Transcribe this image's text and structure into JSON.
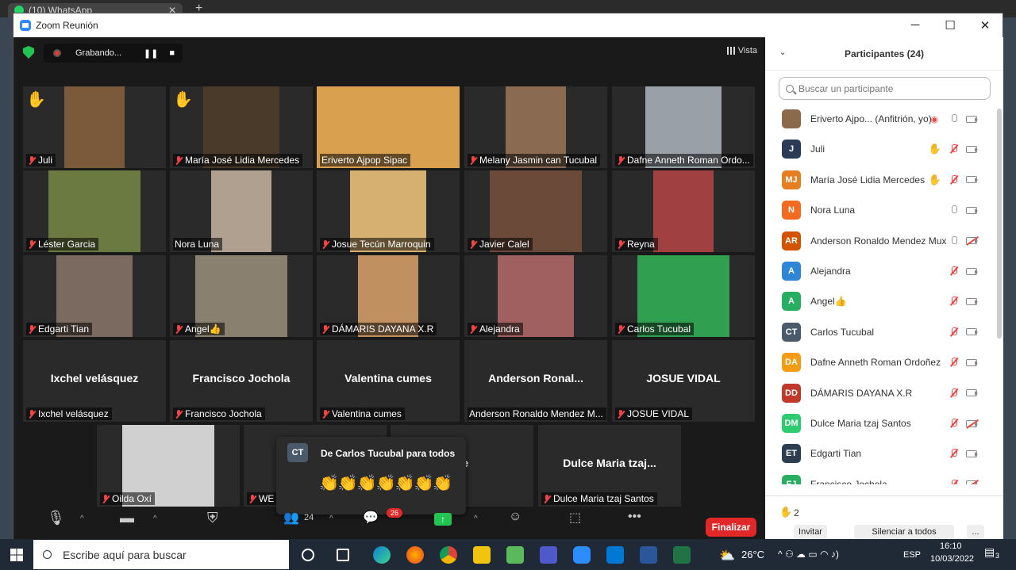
{
  "browser_tab": {
    "label": "(10) WhatsApp"
  },
  "window": {
    "title": "Zoom Reunión"
  },
  "recording": {
    "label": "Grabando..."
  },
  "view": {
    "label": "Vista"
  },
  "tiles": [
    {
      "name": "Juli",
      "hand": true,
      "video": true
    },
    {
      "name": "María José Lidia Mercedes",
      "hand": true,
      "video": true
    },
    {
      "name": "Eriverto Ajpop Sipac",
      "video": true,
      "speaking": true,
      "unmuted": true
    },
    {
      "name": "Melany Jasmin can Tucubal",
      "video": true
    },
    {
      "name": "Dafne Anneth Roman Ordo...",
      "video": true
    },
    {
      "name": "Léster Garcia",
      "video": true
    },
    {
      "name": "Nora Luna",
      "video": true,
      "unmuted": true
    },
    {
      "name": "Josue Tecún Marroquin",
      "video": true
    },
    {
      "name": "Javier Calel",
      "video": true
    },
    {
      "name": "Reyna",
      "video": true
    },
    {
      "name": "Edgarti Tian",
      "video": true
    },
    {
      "name": "Angel👍",
      "video": true
    },
    {
      "name": "DÁMARIS DAYANA X.R",
      "video": true
    },
    {
      "name": "Alejandra",
      "video": true
    },
    {
      "name": "Carlos Tucubal",
      "video": true
    },
    {
      "name": "Ixchel velásquez",
      "big": "Ixchel velásquez"
    },
    {
      "name": "Francisco Jochola",
      "big": "Francisco Jochola"
    },
    {
      "name": "Valentina cumes",
      "big": "Valentina cumes"
    },
    {
      "name": "Anderson Ronaldo Mendez M...",
      "big": "Anderson  Ronal...",
      "unmuted": true
    },
    {
      "name": "JOSUE VIDAL",
      "big": "JOSUE VIDAL"
    },
    {
      "name": "Oilda Oxí",
      "video": true
    },
    {
      "name": "WE",
      "big": "W"
    },
    {
      "name": "",
      "big": "ue"
    },
    {
      "name": "Dulce Maria tzaj Santos",
      "big": "Dulce  Maria  tzaj..."
    }
  ],
  "chat_popup": {
    "avatar": "CT",
    "from": "De Carlos Tucubal para todos",
    "message": "👏👏👏👏👏👏👏"
  },
  "toolbar": {
    "participants_count": "24",
    "chat_badge": "26",
    "end_label": "Finalizar"
  },
  "panel": {
    "title": "Participantes (24)",
    "search_placeholder": "Buscar un participante",
    "participants": [
      {
        "initials": "",
        "name": "Eriverto Ajpo... (Anfitrión, yo)",
        "color": "#8a6a4a",
        "photo": true,
        "mic": "on",
        "cam": "on",
        "recording": true
      },
      {
        "initials": "J",
        "name": "Juli",
        "color": "#2b3a55",
        "hand": true,
        "mic": "off",
        "cam": "on"
      },
      {
        "initials": "MJ",
        "name": "María José Lidia Mercedes",
        "color": "#e67e22",
        "hand": true,
        "mic": "off",
        "cam": "on"
      },
      {
        "initials": "N",
        "name": "Nora Luna",
        "color": "#f26b21",
        "mic": "on",
        "cam": "on"
      },
      {
        "initials": "AR",
        "name": "Anderson Ronaldo Mendez Mux",
        "color": "#d35400",
        "mic": "on",
        "cam": "off"
      },
      {
        "initials": "A",
        "name": "Alejandra",
        "color": "#2f86d6",
        "mic": "off",
        "cam": "on"
      },
      {
        "initials": "A",
        "name": "Angel👍",
        "color": "#27ae60",
        "mic": "off",
        "cam": "on"
      },
      {
        "initials": "CT",
        "name": "Carlos Tucubal",
        "color": "#4b5a6a",
        "mic": "off",
        "cam": "on"
      },
      {
        "initials": "DA",
        "name": "Dafne Anneth Roman Ordoñez",
        "color": "#f39c12",
        "mic": "off",
        "cam": "on"
      },
      {
        "initials": "DD",
        "name": "DÁMARIS DAYANA X.R",
        "color": "#c0392b",
        "mic": "off",
        "cam": "on"
      },
      {
        "initials": "DM",
        "name": "Dulce Maria tzaj Santos",
        "color": "#2ecc71",
        "mic": "off",
        "cam": "off"
      },
      {
        "initials": "ET",
        "name": "Edgarti Tian",
        "color": "#2c3e50",
        "mic": "off",
        "cam": "on"
      },
      {
        "initials": "FJ",
        "name": "Francisco Jochola",
        "color": "#27ae60",
        "mic": "off",
        "cam": "off"
      }
    ],
    "hands_count": "2",
    "invite_label": "Invitar",
    "mute_all_label": "Silenciar a todos",
    "more_label": "..."
  },
  "taskbar": {
    "search_placeholder": "Escribe aquí para buscar",
    "temperature": "26°C",
    "language": "ESP",
    "time": "16:10",
    "date": "10/03/2022",
    "notifications": "3"
  }
}
